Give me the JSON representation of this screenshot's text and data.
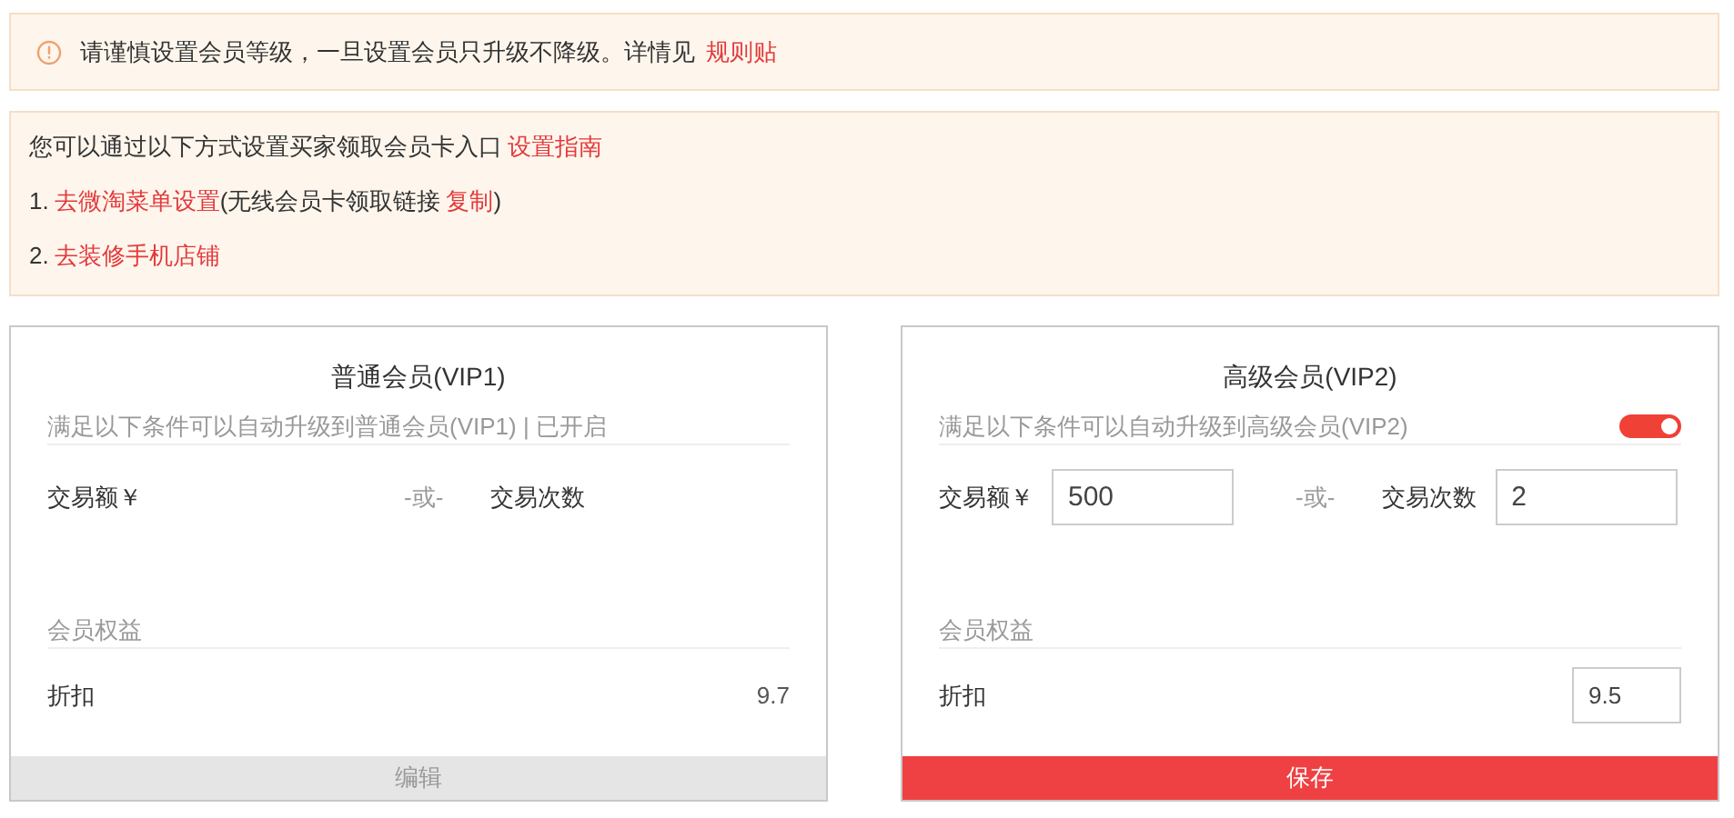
{
  "notice": {
    "text": "请谨慎设置会员等级，一旦设置会员只升级不降级。详情见",
    "link": "规则贴"
  },
  "guide": {
    "intro": "您可以通过以下方式设置买家领取会员卡入口",
    "intro_link": "设置指南",
    "steps": [
      {
        "number": "1.",
        "link": "去微淘菜单设置",
        "note_open": "(无线会员卡领取链接",
        "note_link": "复制",
        "note_close": ")"
      },
      {
        "number": "2.",
        "link": "去装修手机店铺"
      }
    ]
  },
  "cards": [
    {
      "kind": "view",
      "title": "普通会员(VIP1)",
      "condition": "满足以下条件可以自动升级到普通会员(VIP1) | 已开启",
      "amount_label": "交易额￥",
      "or": "-或-",
      "count_label": "交易次数",
      "benefits": "会员权益",
      "discount_label": "折扣",
      "discount_value": "9.7",
      "button": "编辑"
    },
    {
      "kind": "edit",
      "title": "高级会员(VIP2)",
      "condition": "满足以下条件可以自动升级到高级会员(VIP2)",
      "toggle": {
        "on": true
      },
      "amount_label": "交易额￥",
      "amount_value": "500",
      "or": "-或-",
      "count_label": "交易次数",
      "count_value": "2",
      "benefits": "会员权益",
      "discount_label": "折扣",
      "discount_value": "9.5",
      "button": "保存"
    }
  ]
}
